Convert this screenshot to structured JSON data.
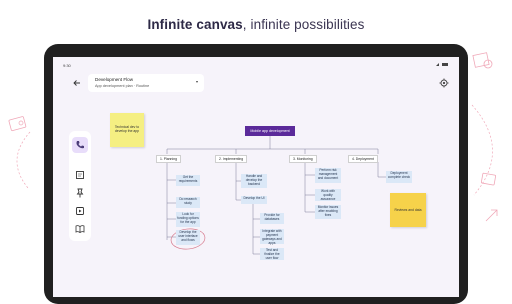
{
  "headline": {
    "bold": "Infinite canvas",
    "rest": ", infinite possibilities"
  },
  "status": {
    "time": "9:30"
  },
  "document": {
    "title": "Development Flow",
    "subtitle": "App development plan · Routine"
  },
  "icons": {
    "back": "arrow-left-icon",
    "dropdown": "chevron-down-icon",
    "settings": "settings-icon",
    "toolbar": [
      "phone-icon",
      "note-icon",
      "pin-icon",
      "media-icon",
      "book-icon"
    ]
  },
  "sticky_notes": [
    {
      "text": "Technical dev to develop the app"
    },
    {
      "text": "Reviews and data"
    }
  ],
  "mindmap": {
    "root": "Mobile app development",
    "categories": [
      "1. Planning",
      "2. Implementing",
      "3. Monitoring",
      "4. Deployment"
    ],
    "planning": [
      "Get the requirements",
      "Do research study",
      "Look for funding options for the app",
      "Develop the user interface and flows"
    ],
    "implementing": [
      "Handle and develop the backend",
      "Develop the UI",
      "Provide for databases",
      "Integrate with payment gateways and apps",
      "Test and finalize the user flow"
    ],
    "monitoring": [
      "Perform risk management and document",
      "Work with quality assurance",
      "Monitor issues after enabling fixes"
    ],
    "deployment": [
      "Deployment complete check"
    ]
  },
  "colors": {
    "accent": "#5b2a9a",
    "node": "#dbe8f7",
    "sticky": "#f5ef82",
    "sticky_orange": "#f6d24a",
    "deco": "#f0a8b8"
  }
}
